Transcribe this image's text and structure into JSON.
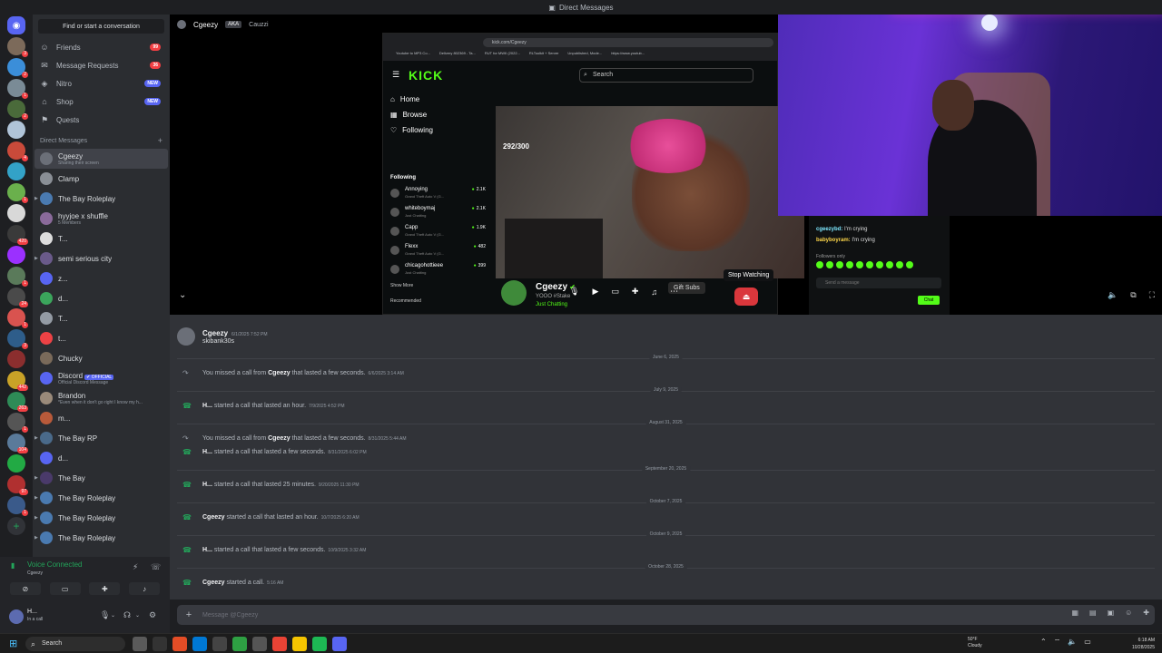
{
  "window": {
    "title": "Direct Messages"
  },
  "rail": {
    "servers": [
      {
        "color": "#5865f2",
        "badge": ""
      },
      {
        "color": "#7c6a5a",
        "badge": "3"
      },
      {
        "color": "#3b8ed9",
        "badge": "2"
      },
      {
        "color": "#7a8b96",
        "badge": "1"
      },
      {
        "color": "#4a6a3a",
        "badge": "2"
      },
      {
        "color": "#b0c4d8",
        "badge": ""
      },
      {
        "color": "#c94a3a",
        "badge": "4"
      },
      {
        "color": "#33a2c7",
        "badge": ""
      },
      {
        "color": "#6ab04c",
        "badge": "1"
      },
      {
        "color": "#d8d8d8",
        "badge": ""
      },
      {
        "color": "#3a3a3a",
        "badge": "420"
      },
      {
        "color": "#9b30ff",
        "badge": ""
      },
      {
        "color": "#5a7a5a",
        "badge": "1"
      },
      {
        "color": "#4a4a4a",
        "badge": "24"
      },
      {
        "color": "#d9534f",
        "badge": "1"
      },
      {
        "color": "#2e5d8a",
        "badge": "3"
      },
      {
        "color": "#8b2e2e",
        "badge": ""
      },
      {
        "color": "#c9a227",
        "badge": "442"
      },
      {
        "color": "#2e8b57",
        "badge": "263"
      },
      {
        "color": "#555555",
        "badge": "1"
      },
      {
        "color": "#5a7a9a",
        "badge": "104"
      },
      {
        "color": "#22aa44",
        "badge": ""
      },
      {
        "color": "#b03030",
        "badge": "97"
      },
      {
        "color": "#3a5a8a",
        "badge": "1"
      }
    ]
  },
  "sidebar": {
    "find_label": "Find or start a conversation",
    "nav": [
      {
        "icon": "friends-icon",
        "glyph": "☺",
        "label": "Friends",
        "pill": "99"
      },
      {
        "icon": "mail-icon",
        "glyph": "✉",
        "label": "Message Requests",
        "pill": "36"
      },
      {
        "icon": "nitro-icon",
        "glyph": "◈",
        "label": "Nitro",
        "pill": "NEW"
      },
      {
        "icon": "shop-icon",
        "glyph": "⌂",
        "label": "Shop",
        "pill": "NEW"
      },
      {
        "icon": "quests-icon",
        "glyph": "⚑",
        "label": "Quests",
        "pill": ""
      }
    ],
    "dm_header": "Direct Messages",
    "dms": [
      {
        "name": "Cgeezy",
        "sub": "Sharing their screen",
        "color": "#6b6f78",
        "active": true,
        "arrow": false
      },
      {
        "name": "Clamp",
        "sub": "",
        "color": "#8a8f96",
        "active": false,
        "arrow": false
      },
      {
        "name": "The Bay Roleplay",
        "sub": "",
        "color": "#4a7ab0",
        "active": false,
        "arrow": true
      },
      {
        "name": "hyyjoe x shuffle",
        "sub": "5 Members",
        "color": "#8a6a9a",
        "active": false,
        "arrow": false
      },
      {
        "name": "T...",
        "sub": "",
        "color": "#dddddd",
        "active": false,
        "arrow": false
      },
      {
        "name": "semi serious city",
        "sub": "",
        "color": "#6a5a8a",
        "active": false,
        "arrow": true
      },
      {
        "name": "z...",
        "sub": "",
        "color": "#5865f2",
        "active": false,
        "arrow": false
      },
      {
        "name": "d...",
        "sub": "",
        "color": "#3ba55c",
        "active": false,
        "arrow": false
      },
      {
        "name": "T...",
        "sub": "",
        "color": "#949ba4",
        "active": false,
        "arrow": false
      },
      {
        "name": "t...",
        "sub": "",
        "color": "#ed4245",
        "active": false,
        "arrow": false
      },
      {
        "name": "Chucky",
        "sub": "",
        "color": "#7a6a5a",
        "active": false,
        "arrow": false
      },
      {
        "name": "Discord",
        "sub": "Official Discord Message",
        "color": "#5865f2",
        "active": false,
        "arrow": false,
        "tag": "✔ OFFICIAL"
      },
      {
        "name": "Brandon",
        "sub": "*Even when it don't go right I know my h...",
        "color": "#9a8a7a",
        "active": false,
        "arrow": false
      },
      {
        "name": "m...",
        "sub": "",
        "color": "#b85a3a",
        "active": false,
        "arrow": false
      },
      {
        "name": "The Bay RP",
        "sub": "",
        "color": "#4a6a8a",
        "active": false,
        "arrow": true
      },
      {
        "name": "d...",
        "sub": "",
        "color": "#5865f2",
        "active": false,
        "arrow": false
      },
      {
        "name": "The Bay",
        "sub": "",
        "color": "#4a3a6a",
        "active": false,
        "arrow": true
      },
      {
        "name": "The Bay Roleplay",
        "sub": "",
        "color": "#4a7ab0",
        "active": false,
        "arrow": true
      },
      {
        "name": "The Bay Roleplay",
        "sub": "",
        "color": "#4a7ab0",
        "active": false,
        "arrow": true
      },
      {
        "name": "The Bay Roleplay",
        "sub": "",
        "color": "#4a7ab0",
        "active": false,
        "arrow": true
      }
    ]
  },
  "voice": {
    "title": "Voice Connected",
    "sub": "Cgeezy"
  },
  "user": {
    "name": "H...",
    "status": "In a call"
  },
  "stream": {
    "user": "Cgeezy",
    "aka_label": "AKA",
    "aka": "Cauzzi",
    "browser_url": "kick.com/Cgeezy",
    "bookmarks": [
      "Youtube to MP3 Co...",
      "Delivery 802369 - Ta...",
      "RUT for MWII (2022...",
      "RLToolkit + Server",
      "Unpublished, Mode...",
      "https://www.youtub..."
    ],
    "kick_logo": "KICK",
    "kick_search": "Search",
    "kick_nav": [
      {
        "glyph": "⌂",
        "label": "Home"
      },
      {
        "glyph": "▦",
        "label": "Browse"
      },
      {
        "glyph": "♡",
        "label": "Following"
      }
    ],
    "following_label": "Following",
    "following": [
      {
        "name": "Annoying",
        "game": "Grand Theft Auto V (G...",
        "viewers": "2.1K"
      },
      {
        "name": "whiteboymaj",
        "game": "Just Chatting",
        "viewers": "2.1K"
      },
      {
        "name": "Capp",
        "game": "Grand Theft Auto V (G...",
        "viewers": "1.9K"
      },
      {
        "name": "Flexx",
        "game": "Grand Theft Auto V (G...",
        "viewers": "482"
      },
      {
        "name": "chicagohottieee",
        "game": "Just Chatting",
        "viewers": "399"
      }
    ],
    "show_more": "Show More",
    "recommended": "Recommended",
    "viewer_count": "292/300",
    "channel_name": "Cgeezy",
    "channel_sub": "YOOO #Stake",
    "channel_game": "Just Chatting",
    "gift_subs": "Gift Subs",
    "chat_lines": [
      {
        "user": "cgeezybd:",
        "text": "I'm crying"
      },
      {
        "user": "babyboyram:",
        "text": "I'm crying"
      }
    ],
    "followers_only": "Followers only",
    "send_placeholder": "Send a message",
    "chat_button": "Chat",
    "stop_watching": "Stop Watching"
  },
  "messages": {
    "first": {
      "author": "Cgeezy",
      "timestamp": "6/1/2025 7:52 PM",
      "text": "skibank30s"
    },
    "items": [
      {
        "type": "divider",
        "label": "June 6, 2025"
      },
      {
        "type": "call",
        "icon": "gray",
        "prefix": "You missed a call from",
        "who": "Cgeezy",
        "suffix": "that lasted a few seconds.",
        "ts": "6/6/2025 3:14 AM"
      },
      {
        "type": "divider",
        "label": "July 9, 2025"
      },
      {
        "type": "call",
        "icon": "green",
        "prefix": "",
        "who": "H...",
        "suffix": "started a call that lasted an hour.",
        "ts": "7/9/2025 4:52 PM"
      },
      {
        "type": "divider",
        "label": "August 31, 2025"
      },
      {
        "type": "call",
        "icon": "gray",
        "prefix": "You missed a call from",
        "who": "Cgeezy",
        "suffix": "that lasted a few seconds.",
        "ts": "8/31/2025 5:44 AM"
      },
      {
        "type": "call",
        "icon": "green",
        "prefix": "",
        "who": "H...",
        "suffix": "started a call that lasted a few seconds.",
        "ts": "8/31/2025 6:02 PM"
      },
      {
        "type": "divider",
        "label": "September 20, 2025"
      },
      {
        "type": "call",
        "icon": "green",
        "prefix": "",
        "who": "H...",
        "suffix": "started a call that lasted 25 minutes.",
        "ts": "9/20/2025 11:30 PM"
      },
      {
        "type": "divider",
        "label": "October 7, 2025"
      },
      {
        "type": "call",
        "icon": "green",
        "prefix": "",
        "who": "Cgeezy",
        "suffix": "started a call that lasted an hour.",
        "ts": "10/7/2025 6:20 AM"
      },
      {
        "type": "divider",
        "label": "October 9, 2025"
      },
      {
        "type": "call",
        "icon": "green",
        "prefix": "",
        "who": "H...",
        "suffix": "started a call that lasted a few seconds.",
        "ts": "10/9/2025 3:32 AM"
      },
      {
        "type": "divider",
        "label": "October 28, 2025"
      },
      {
        "type": "call",
        "icon": "green",
        "prefix": "",
        "who": "Cgeezy",
        "suffix": "started a call.",
        "ts": "5:16 AM"
      }
    ]
  },
  "input": {
    "placeholder": "Message @Cgeezy"
  },
  "taskbar": {
    "search": "Search",
    "weather_temp": "50°F",
    "weather_desc": "Cloudy",
    "time": "6:18 AM",
    "date": "10/28/2025",
    "apps": [
      "#5a5a5a",
      "#333",
      "#e44d26",
      "#0078d4",
      "#444",
      "#2ea043",
      "#555",
      "#ea4335",
      "#f5c400",
      "#1db954",
      "#5865f2"
    ]
  }
}
